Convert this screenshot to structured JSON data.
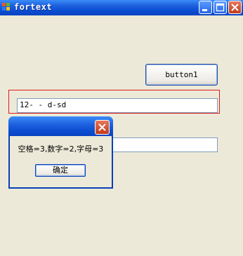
{
  "window": {
    "title": "fortext"
  },
  "form": {
    "button1_label": "button1",
    "textbox1_value": "12-  - d-sd",
    "textbox2_value": ""
  },
  "dialog": {
    "message": "空格=3,数字=2,字母=3",
    "ok_label": "确定"
  },
  "icons": {
    "app": "windows-form-icon",
    "minimize": "minimize-icon",
    "maximize": "maximize-icon",
    "close": "close-icon"
  },
  "colors": {
    "titlebar": "#0b4cd0",
    "window_bg": "#ece9d8",
    "group_border": "#e01a1a",
    "close_button": "#c23b1c"
  }
}
